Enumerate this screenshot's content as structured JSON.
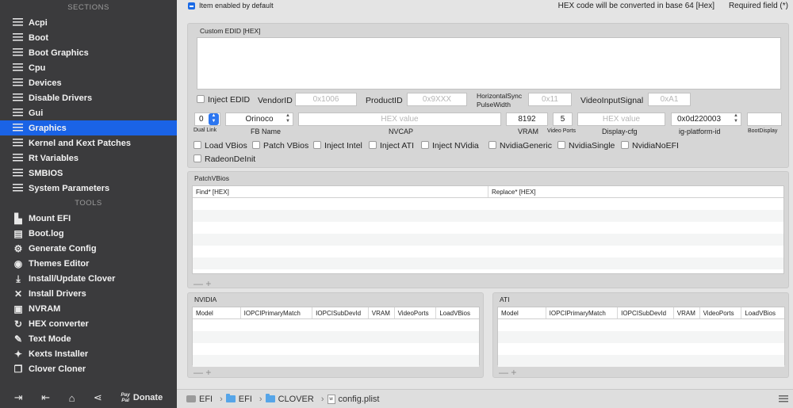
{
  "sidebar": {
    "sections_header": "SECTIONS",
    "sections": [
      {
        "label": "Acpi",
        "selected": false
      },
      {
        "label": "Boot",
        "selected": false
      },
      {
        "label": "Boot Graphics",
        "selected": false
      },
      {
        "label": "Cpu",
        "selected": false
      },
      {
        "label": "Devices",
        "selected": false
      },
      {
        "label": "Disable Drivers",
        "selected": false
      },
      {
        "label": "Gui",
        "selected": false
      },
      {
        "label": "Graphics",
        "selected": true
      },
      {
        "label": "Kernel and Kext Patches",
        "selected": false
      },
      {
        "label": "Rt Variables",
        "selected": false
      },
      {
        "label": "SMBIOS",
        "selected": false
      },
      {
        "label": "System Parameters",
        "selected": false
      }
    ],
    "tools_header": "TOOLS",
    "tools": [
      {
        "label": "Mount EFI",
        "icon": "mount-icon",
        "glyph": "▙"
      },
      {
        "label": "Boot.log",
        "icon": "log-icon",
        "glyph": "▤"
      },
      {
        "label": "Generate Config",
        "icon": "gear-icon",
        "glyph": "⚙"
      },
      {
        "label": "Themes Editor",
        "icon": "palette-icon",
        "glyph": "◉"
      },
      {
        "label": "Install/Update Clover",
        "icon": "download-icon",
        "glyph": "⤓"
      },
      {
        "label": "Install Drivers",
        "icon": "wrench-icon",
        "glyph": "✕"
      },
      {
        "label": "NVRAM",
        "icon": "chip-icon",
        "glyph": "▣"
      },
      {
        "label": "HEX converter",
        "icon": "refresh-icon",
        "glyph": "↻"
      },
      {
        "label": "Text Mode",
        "icon": "pen-icon",
        "glyph": "✎"
      },
      {
        "label": "Kexts Installer",
        "icon": "puzzle-icon",
        "glyph": "✦"
      },
      {
        "label": "Clover Cloner",
        "icon": "clone-icon",
        "glyph": "❐"
      }
    ],
    "bottom": {
      "paypal_top": "Pay",
      "paypal_bottom": "Pal",
      "donate": "Donate"
    }
  },
  "topbar": {
    "item_enabled": "Item enabled by default",
    "hex_note": "HEX code will be converted in base 64 [Hex]",
    "required": "Required field (*)"
  },
  "edid": {
    "title": "Custom EDID [HEX]",
    "inject_edid": "Inject EDID",
    "vendor_id_label": "VendorID",
    "vendor_id_placeholder": "0x1006",
    "product_id_label": "ProductID",
    "product_id_placeholder": "0x9XXX",
    "hsync_label_1": "HorizontalSync",
    "hsync_label_2": "PulseWidth",
    "hsync_placeholder": "0x11",
    "video_input_label": "VideoInputSignal",
    "video_input_placeholder": "0xA1"
  },
  "graphics": {
    "dual_link_value": "0",
    "dual_link_label": "Dual Link",
    "fb_name_value": "Orinoco",
    "fb_name_label": "FB Name",
    "nvcap_placeholder": "HEX value",
    "nvcap_label": "NVCAP",
    "vram_value": "8192",
    "vram_label": "VRAM",
    "video_ports_value": "5",
    "video_ports_label": "Video Ports",
    "display_cfg_placeholder": "HEX value",
    "display_cfg_label": "Display-cfg",
    "ig_platform_value": "0x0d220003",
    "ig_platform_label": "ig-platform-id",
    "boot_display_label": "BootDisplay"
  },
  "checkboxes": [
    "Load VBios",
    "Patch VBios",
    "Inject Intel",
    "Inject ATI",
    "Inject NVidia",
    "NvidiaGeneric",
    "NvidiaSingle",
    "NvidiaNoEFI",
    "RadeonDeInit"
  ],
  "patch_vbios": {
    "title": "PatchVBios",
    "columns": [
      "Find* [HEX]",
      "Replace* [HEX]"
    ],
    "add_remove": "— +"
  },
  "nvidia": {
    "title": "NVIDIA",
    "columns": [
      "Model",
      "IOPCIPrimaryMatch",
      "IOPCISubDevId",
      "VRAM",
      "VideoPorts",
      "LoadVBios"
    ],
    "add_remove": "— +"
  },
  "ati": {
    "title": "ATI",
    "columns": [
      "Model",
      "IOPCIPrimaryMatch",
      "IOPCISubDevId",
      "VRAM",
      "VideoPorts",
      "LoadVBios"
    ],
    "add_remove": "— +"
  },
  "statusbar": {
    "crumbs": [
      "EFI",
      "EFI",
      "CLOVER",
      "config.plist"
    ]
  }
}
